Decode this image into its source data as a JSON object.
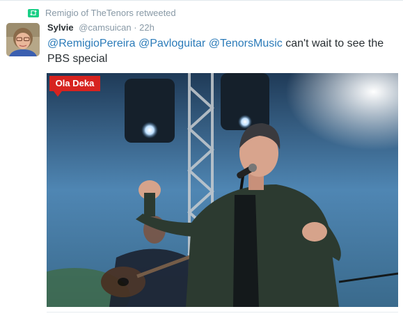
{
  "retweet_context": {
    "text": "Remigio of TheTenors retweeted",
    "icon": "retweet-icon"
  },
  "tweet": {
    "fullname": "Sylvie",
    "username": "@camsuican",
    "separator": "·",
    "timestamp": "22h",
    "mentions": [
      "@RemigioPereira",
      "@Pavloguitar",
      "@TenorsMusic"
    ],
    "text_rest": "can't wait to see the PBS special"
  },
  "media": {
    "watermark": "Ola Deka",
    "watermark_color": "#d7231f"
  },
  "colors": {
    "link": "#2b7bb9",
    "secondary": "#8899a6",
    "retweet_green": "#19cf86"
  }
}
